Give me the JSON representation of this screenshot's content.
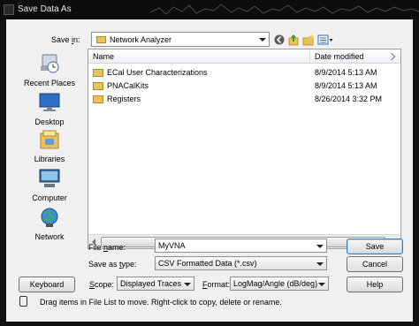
{
  "window": {
    "title": "Save Data As"
  },
  "save_in": {
    "label": "Save in:",
    "value": "Network Analyzer"
  },
  "places": [
    {
      "label": "Recent Places",
      "icon": "recent-places-icon"
    },
    {
      "label": "Desktop",
      "icon": "desktop-icon"
    },
    {
      "label": "Libraries",
      "icon": "libraries-icon"
    },
    {
      "label": "Computer",
      "icon": "computer-icon"
    },
    {
      "label": "Network",
      "icon": "network-icon"
    }
  ],
  "file_list": {
    "columns": {
      "name": "Name",
      "date": "Date modified"
    },
    "rows": [
      {
        "name": "ECal User Characterizations",
        "date": "8/9/2014 5:13 AM"
      },
      {
        "name": "PNACalKits",
        "date": "8/9/2014 5:13 AM"
      },
      {
        "name": "Registers",
        "date": "8/26/2014 3:32 PM"
      }
    ]
  },
  "file_name": {
    "label": "File name:",
    "value": "MyVNA"
  },
  "save_as_type": {
    "label": "Save as type:",
    "value": "CSV Formatted Data (*.csv)"
  },
  "scope": {
    "label": "Scope:",
    "value": "Displayed Traces"
  },
  "format": {
    "label": "Format:",
    "value": "LogMag/Angle (dB/deg)"
  },
  "buttons": {
    "save": "Save",
    "cancel": "Cancel",
    "keyboard": "Keyboard",
    "help": "Help"
  },
  "hint": "Drag items in File List to move.  Right-click to copy, delete or rename.",
  "colors": {
    "folder": "#e9c25c",
    "title_bg": "#0d0d0d",
    "dialog_bg": "#f0f0f0",
    "default_button_border": "#3c7fb1"
  }
}
